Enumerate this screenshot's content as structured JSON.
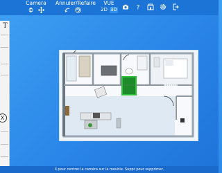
{
  "toolbar": {
    "camera_label": "Camera",
    "undo_redo_label": "Annuler/Refaire",
    "vue_label": "VUE",
    "view_2d": "2D",
    "view_3d": "3D",
    "active_view": "3D",
    "icons": {
      "camera_left": "rotate-camera-icon",
      "camera_right": "move-camera-icon",
      "undo": "undo-icon",
      "redo": "redo-icon",
      "right": [
        "camera-photo-icon",
        "help-icon",
        "store-icon",
        "settings-icon",
        "exit-icon"
      ]
    }
  },
  "side_panel": {
    "letter": "T",
    "close_label": "X"
  },
  "status_bar": {
    "text": "Il pour centrer la caméra sur le meuble. Suppr pour supprimer."
  },
  "colors": {
    "background": "#2a86e8",
    "toolbar": "#1c74d6",
    "selection": "#2bbf3a"
  }
}
